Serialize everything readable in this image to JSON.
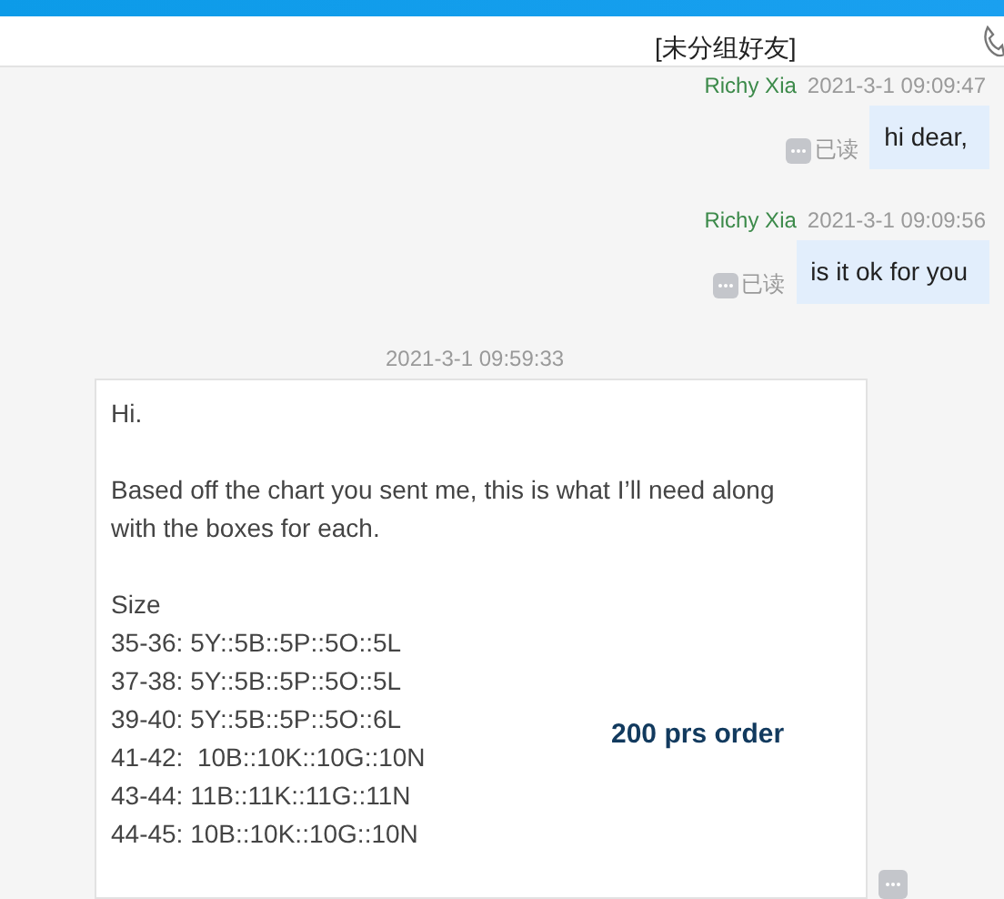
{
  "window": {
    "title": "[未分组好友]"
  },
  "messages": [
    {
      "kind": "sent",
      "sender": "Richy Xia",
      "time": "2021-3-1 09:09:47",
      "read_label": "已读",
      "paragraphs": [
        [
          "hi dear,"
        ]
      ]
    },
    {
      "kind": "sent",
      "sender": "Richy Xia",
      "time": "2021-3-1 09:09:56",
      "read_label": "已读",
      "paragraphs": [
        [
          "is it ok for you"
        ]
      ]
    },
    {
      "kind": "received",
      "time": "2021-3-1 09:59:33",
      "annotation": "200 prs order",
      "paragraphs": [
        [
          "Hi."
        ],
        [
          "Based off the chart you sent me, this is what I’ll need along with the boxes for each."
        ],
        [
          "Size",
          "35-36: 5Y::5B::5P::5O::5L",
          "37-38: 5Y::5B::5P::5O::5L",
          "39-40: 5Y::5B::5P::5O::6L",
          "41-42:  10B::10K::10G::10N",
          "43-44: 11B::11K::11G::11N",
          "44-45: 10B::10K::10G::10N"
        ]
      ]
    }
  ]
}
